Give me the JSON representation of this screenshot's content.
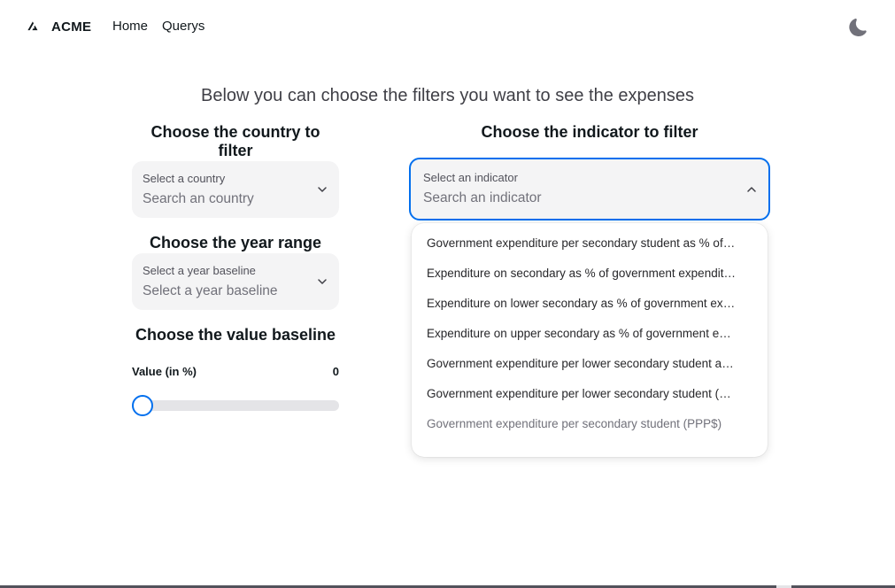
{
  "navbar": {
    "brand": "ACME",
    "brand_icon": "acme-logo-icon",
    "links": [
      "Home",
      "Querys"
    ],
    "theme_icon": "moon-icon"
  },
  "intro": "Below you can choose the filters you want to see the expenses",
  "country": {
    "title": "Choose the country to filter",
    "label": "Select a country",
    "placeholder": "Search an country"
  },
  "year": {
    "title": "Choose the year range",
    "label": "Select a year baseline",
    "placeholder": "Select a year baseline"
  },
  "value": {
    "title": "Choose the value baseline",
    "label": "Value (in %)",
    "current": "0",
    "fraction": 0
  },
  "indicator": {
    "title": "Choose the indicator to filter",
    "label": "Select an indicator",
    "placeholder": "Search an indicator",
    "options": [
      "Government expenditure per secondary student as % of GDP per capita",
      "Expenditure on secondary as % of government expenditure on education",
      "Expenditure on lower secondary as % of government expenditure on education",
      "Expenditure on upper secondary as % of government expenditure on education",
      "Government expenditure per lower secondary student as % of GDP per capita",
      "Government expenditure per lower secondary student (PPP$)",
      "Government expenditure per secondary student (PPP$)"
    ]
  },
  "colors": {
    "accent": "#006fee",
    "field_bg": "#f4f4f5",
    "text": "#11181c"
  }
}
